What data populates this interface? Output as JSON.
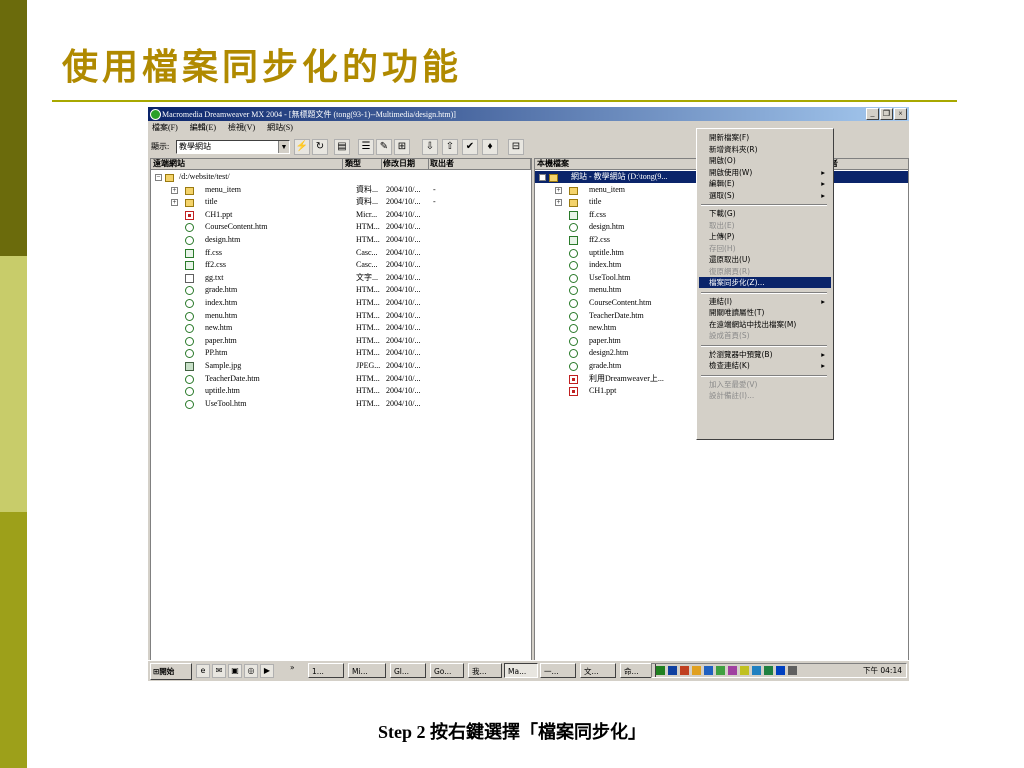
{
  "slide": {
    "title": "使用檔案同步化的功能",
    "caption": "Step 2 按右鍵選擇「檔案同步化」"
  },
  "window": {
    "title": "Macromedia Dreamweaver MX 2004 - [無標題文件 (tong(93-1)--Multimedia/design.htm)]",
    "controls": [
      "_",
      "❐",
      "×"
    ]
  },
  "menubar": [
    "檔案(F)",
    "編輯(E)",
    "檢視(V)",
    "網站(S)"
  ],
  "toolbar": {
    "show_label": "顯示:",
    "site_value": "教學網站"
  },
  "remote_pane": {
    "columns": [
      "遠端網站",
      "類型",
      "修改日期",
      "取出者"
    ],
    "root": "/d:/website/test/",
    "files": [
      {
        "name": "menu_item",
        "type": "資料...",
        "date": "2004/10/...",
        "by": "-",
        "icon": "folder"
      },
      {
        "name": "title",
        "type": "資料...",
        "date": "2004/10/...",
        "by": "-",
        "icon": "folder"
      },
      {
        "name": "CH1.ppt",
        "type": "Micr...",
        "date": "2004/10/...",
        "by": "",
        "icon": "ppt"
      },
      {
        "name": "CourseContent.htm",
        "type": "HTM...",
        "date": "2004/10/...",
        "by": "",
        "icon": "htm"
      },
      {
        "name": "design.htm",
        "type": "HTM...",
        "date": "2004/10/...",
        "by": "",
        "icon": "htm"
      },
      {
        "name": "ff.css",
        "type": "Casc...",
        "date": "2004/10/...",
        "by": "",
        "icon": "css"
      },
      {
        "name": "ff2.css",
        "type": "Casc...",
        "date": "2004/10/...",
        "by": "",
        "icon": "css"
      },
      {
        "name": "gg.txt",
        "type": "文字...",
        "date": "2004/10/...",
        "by": "",
        "icon": "doc"
      },
      {
        "name": "grade.htm",
        "type": "HTM...",
        "date": "2004/10/...",
        "by": "",
        "icon": "htm"
      },
      {
        "name": "index.htm",
        "type": "HTM...",
        "date": "2004/10/...",
        "by": "",
        "icon": "htm"
      },
      {
        "name": "menu.htm",
        "type": "HTM...",
        "date": "2004/10/...",
        "by": "",
        "icon": "htm"
      },
      {
        "name": "new.htm",
        "type": "HTM...",
        "date": "2004/10/...",
        "by": "",
        "icon": "htm"
      },
      {
        "name": "paper.htm",
        "type": "HTM...",
        "date": "2004/10/...",
        "by": "",
        "icon": "htm"
      },
      {
        "name": "PP.htm",
        "type": "HTM...",
        "date": "2004/10/...",
        "by": "",
        "icon": "htm"
      },
      {
        "name": "Sample.jpg",
        "type": "JPEG...",
        "date": "2004/10/...",
        "by": "",
        "icon": "img"
      },
      {
        "name": "TeacherDate.htm",
        "type": "HTM...",
        "date": "2004/10/...",
        "by": "",
        "icon": "htm"
      },
      {
        "name": "uptitle.htm",
        "type": "HTM...",
        "date": "2004/10/...",
        "by": "",
        "icon": "htm"
      },
      {
        "name": "UseTool.htm",
        "type": "HTM...",
        "date": "2004/10/...",
        "by": "",
        "icon": "htm"
      }
    ]
  },
  "local_pane": {
    "columns": [
      "本機檔案",
      "者"
    ],
    "root": "網站 - 教學網站 (D:\\tong(9...",
    "files": [
      {
        "name": "menu_item",
        "icon": "folder"
      },
      {
        "name": "title",
        "icon": "folder"
      },
      {
        "name": "ff.css",
        "icon": "css"
      },
      {
        "name": "design.htm",
        "icon": "htm"
      },
      {
        "name": "ff2.css",
        "icon": "css"
      },
      {
        "name": "uptitle.htm",
        "icon": "htm"
      },
      {
        "name": "index.htm",
        "icon": "htm"
      },
      {
        "name": "UseTool.htm",
        "icon": "htm"
      },
      {
        "name": "menu.htm",
        "icon": "htm"
      },
      {
        "name": "CourseContent.htm",
        "icon": "htm"
      },
      {
        "name": "TeacherDate.htm",
        "icon": "htm"
      },
      {
        "name": "new.htm",
        "icon": "htm"
      },
      {
        "name": "paper.htm",
        "icon": "htm"
      },
      {
        "name": "design2.htm",
        "icon": "htm"
      },
      {
        "name": "grade.htm",
        "icon": "htm"
      },
      {
        "name": "利用Dreamweaver上...",
        "icon": "ppt"
      },
      {
        "name": "CH1.ppt",
        "icon": "ppt"
      }
    ]
  },
  "context_menu": {
    "items": [
      {
        "label": "開新檔案(F)",
        "disabled": false,
        "submenu": false
      },
      {
        "label": "新增資料夾(R)",
        "disabled": false,
        "submenu": false
      },
      {
        "label": "開啟(O)",
        "disabled": false,
        "submenu": false
      },
      {
        "label": "開啟使用(W)",
        "disabled": false,
        "submenu": true
      },
      {
        "label": "編輯(E)",
        "disabled": false,
        "submenu": true
      },
      {
        "label": "選取(S)",
        "disabled": false,
        "submenu": true
      },
      {
        "sep": true
      },
      {
        "label": "下載(G)",
        "disabled": false,
        "submenu": false
      },
      {
        "label": "取出(E)",
        "disabled": true,
        "submenu": false
      },
      {
        "label": "上傳(P)",
        "disabled": false,
        "submenu": false
      },
      {
        "label": "存回(H)",
        "disabled": true,
        "submenu": false
      },
      {
        "label": "還原取出(U)",
        "disabled": false,
        "submenu": false
      },
      {
        "label": "復原網頁(R)",
        "disabled": true,
        "submenu": false
      },
      {
        "label": "檔案同步化(Z)...",
        "disabled": false,
        "submenu": false,
        "highlight": true
      },
      {
        "sep": true
      },
      {
        "label": "連結(I)",
        "disabled": false,
        "submenu": true
      },
      {
        "label": "開關唯讀屬性(T)",
        "disabled": false,
        "submenu": false
      },
      {
        "label": "在遠端網站中找出檔案(M)",
        "disabled": false,
        "submenu": false
      },
      {
        "label": "設成首頁(S)",
        "disabled": true,
        "submenu": false
      },
      {
        "sep": true
      },
      {
        "label": "於瀏覽器中預覽(B)",
        "disabled": false,
        "submenu": true
      },
      {
        "label": "檢查連結(K)",
        "disabled": false,
        "submenu": true
      },
      {
        "sep": true
      },
      {
        "label": "加入至最愛(V)",
        "disabled": true,
        "submenu": false
      },
      {
        "label": "設計備註(I)...",
        "disabled": true,
        "submenu": false
      }
    ]
  },
  "taskbar": {
    "start_label": "開始",
    "tasks": [
      "1...",
      "Mi...",
      "Gl...",
      "Go...",
      "我...",
      "Ma...",
      "一...",
      "文...",
      "命..."
    ],
    "active_task": "Ma...",
    "clock": "下午 04:14"
  }
}
